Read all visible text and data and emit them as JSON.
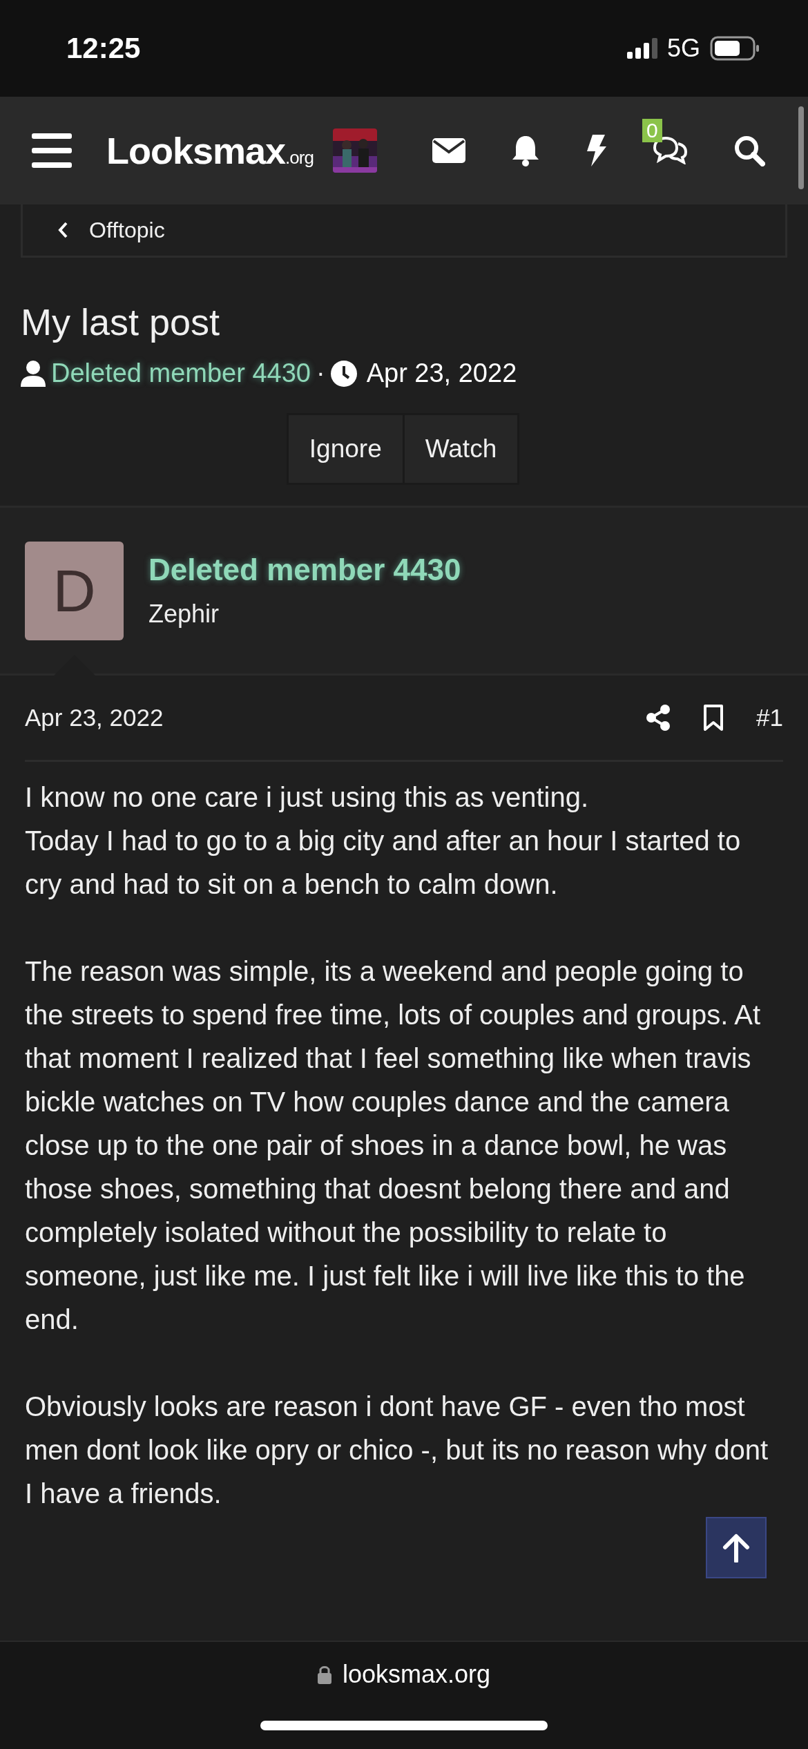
{
  "status_bar": {
    "time": "12:25",
    "network": "5G"
  },
  "nav": {
    "logo_main": "Looksmax",
    "logo_suffix": ".org",
    "chat_badge": "0"
  },
  "breadcrumb": {
    "label": "Offtopic"
  },
  "thread": {
    "title": "My last post",
    "author": "Deleted member 4430",
    "separator": "·",
    "date": "Apr 23, 2022",
    "buttons": [
      "Ignore",
      "Watch"
    ]
  },
  "post": {
    "avatar_letter": "D",
    "username": "Deleted member 4430",
    "user_title": "Zephir",
    "date": "Apr 23, 2022",
    "number": "#1",
    "paragraphs": [
      "I know no one care i just using this as venting.\nToday I had to go to a big city and after an hour I started to cry and had to sit on a bench to calm down.",
      "The reason was simple, its a weekend and people going to the streets to spend free time, lots of couples and groups. At that moment I realized that I feel something like when travis bickle watches on TV how couples dance and the camera close up to the one pair of shoes in a dance bowl, he was those shoes, something that doesnt belong there and and completely isolated without the possibility to relate to someone, just like me. I just felt like i will live like this to the end.",
      "Obviously looks are reason i dont have GF - even tho most men dont look like opry or chico -, but its no reason why dont I have a friends."
    ]
  },
  "browser_bar": {
    "url": "looksmax.org"
  }
}
